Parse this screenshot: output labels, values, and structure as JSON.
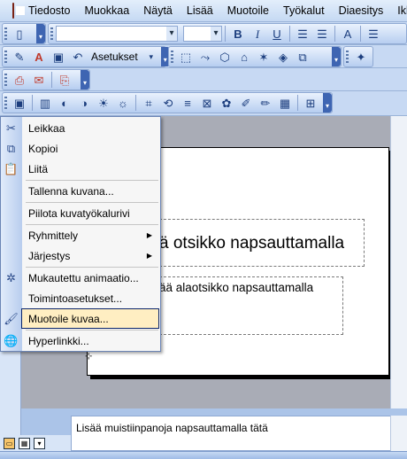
{
  "menubar": {
    "items": [
      {
        "label": "Tiedosto"
      },
      {
        "label": "Muokkaa"
      },
      {
        "label": "Näytä"
      },
      {
        "label": "Lisää"
      },
      {
        "label": "Muotoile"
      },
      {
        "label": "Työkalut"
      },
      {
        "label": "Diaesitys"
      },
      {
        "label": "Ikk"
      }
    ]
  },
  "toolbars": {
    "formatting": {
      "font_name": "",
      "font_size": ""
    },
    "drawing": {
      "settings_label": "Asetukset"
    }
  },
  "context_menu": {
    "items": [
      {
        "label": "Leikkaa",
        "icon": "scissors-icon"
      },
      {
        "label": "Kopioi",
        "icon": "copy-icon"
      },
      {
        "label": "Liitä",
        "icon": "paste-icon"
      },
      {
        "label": "Tallenna kuvana..."
      },
      {
        "label": "Piilota kuvatyökalurivi"
      },
      {
        "label": "Ryhmittely",
        "submenu": true
      },
      {
        "label": "Järjestys",
        "submenu": true
      },
      {
        "label": "Mukautettu animaatio...",
        "icon": "custom-animation-icon"
      },
      {
        "label": "Toimintoasetukset..."
      },
      {
        "label": "Muotoile kuvaa...",
        "icon": "format-picture-icon",
        "highlighted": true
      },
      {
        "label": "Hyperlinkki...",
        "icon": "hyperlink-icon"
      }
    ]
  },
  "slide": {
    "title_placeholder": "ä otsikko napsauttamalla",
    "subtitle_placeholder": "ää alaotsikko napsauttamalla"
  },
  "notes": {
    "placeholder": "Lisää muistiinpanoja napsauttamalla tätä"
  },
  "colors": {
    "menu_highlight": "#ffeec2",
    "highlight_border": "#0a246a",
    "toolbar": "#c7d9f3",
    "workspace": "#a9acb6"
  }
}
